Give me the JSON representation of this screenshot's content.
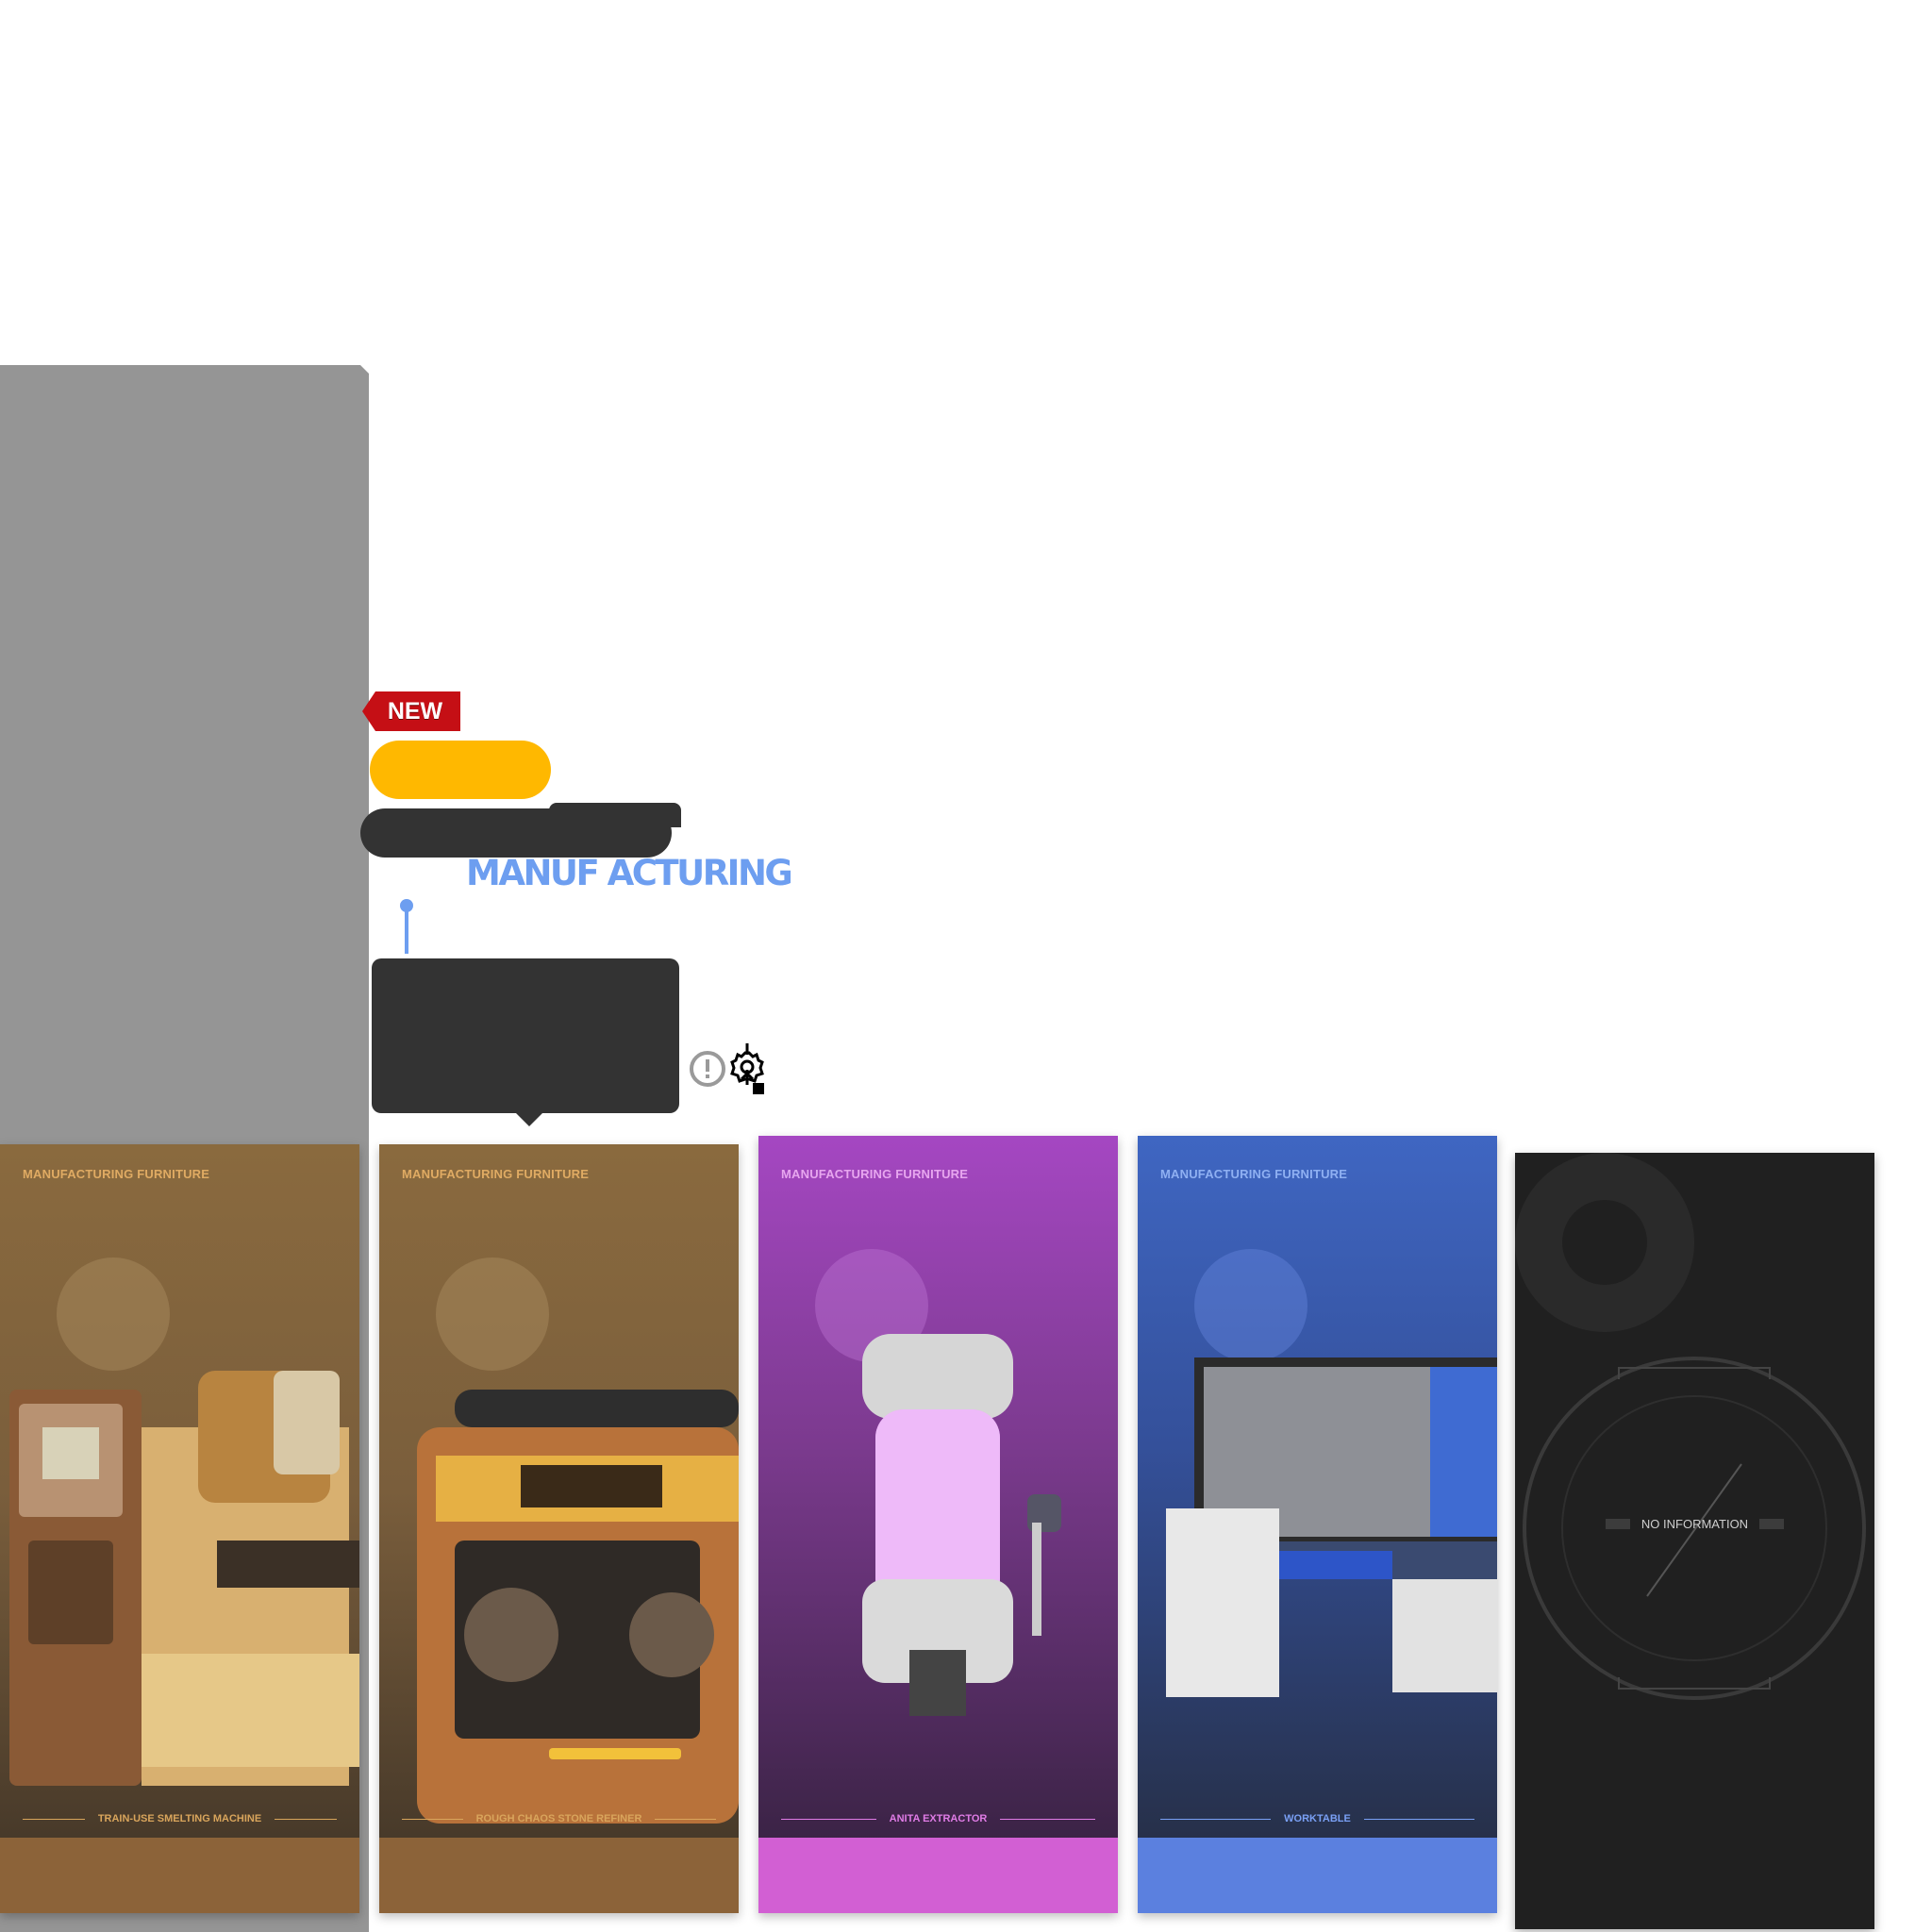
{
  "badge": {
    "new": "NEW"
  },
  "section": {
    "title": "MANUF ACTURING"
  },
  "cards": [
    {
      "tag": "MANUFACTURING FURNITURE",
      "name": "TRAIN-USE SMELTING MACHINE",
      "theme": "bronze",
      "colors": {
        "top": "#8a6a3e",
        "bottom": "#3d3226",
        "footer": "#8c6339",
        "tag": "#e0ab63",
        "name": "#d9a55c"
      }
    },
    {
      "tag": "MANUFACTURING FURNITURE",
      "name": "ROUGH CHAOS STONE REFINER",
      "theme": "bronze",
      "colors": {
        "top": "#8a6a3e",
        "bottom": "#3d3226",
        "footer": "#8c6339",
        "tag": "#e0ab63",
        "name": "#d9a55c"
      }
    },
    {
      "tag": "MANUFACTURING FURNITURE",
      "name": "ANITA EXTRACTOR",
      "theme": "purple",
      "colors": {
        "top": "#a547c2",
        "bottom": "#2f1f38",
        "footer": "#d25fd3",
        "tag": "#e7a6ef",
        "name": "#e07ce6"
      }
    },
    {
      "tag": "MANUFACTURING FURNITURE",
      "name": "WORKTABLE",
      "theme": "blue",
      "colors": {
        "top": "#3f66c2",
        "bottom": "#242a3a",
        "footer": "#5b80df",
        "tag": "#8fb0f2",
        "name": "#7aa0f5"
      }
    }
  ],
  "empty_card": {
    "label": "NO INFORMATION"
  },
  "icons": {
    "info": "info-circle-icon",
    "gear": "gear-upgrade-icon",
    "pin": "pin-icon"
  }
}
